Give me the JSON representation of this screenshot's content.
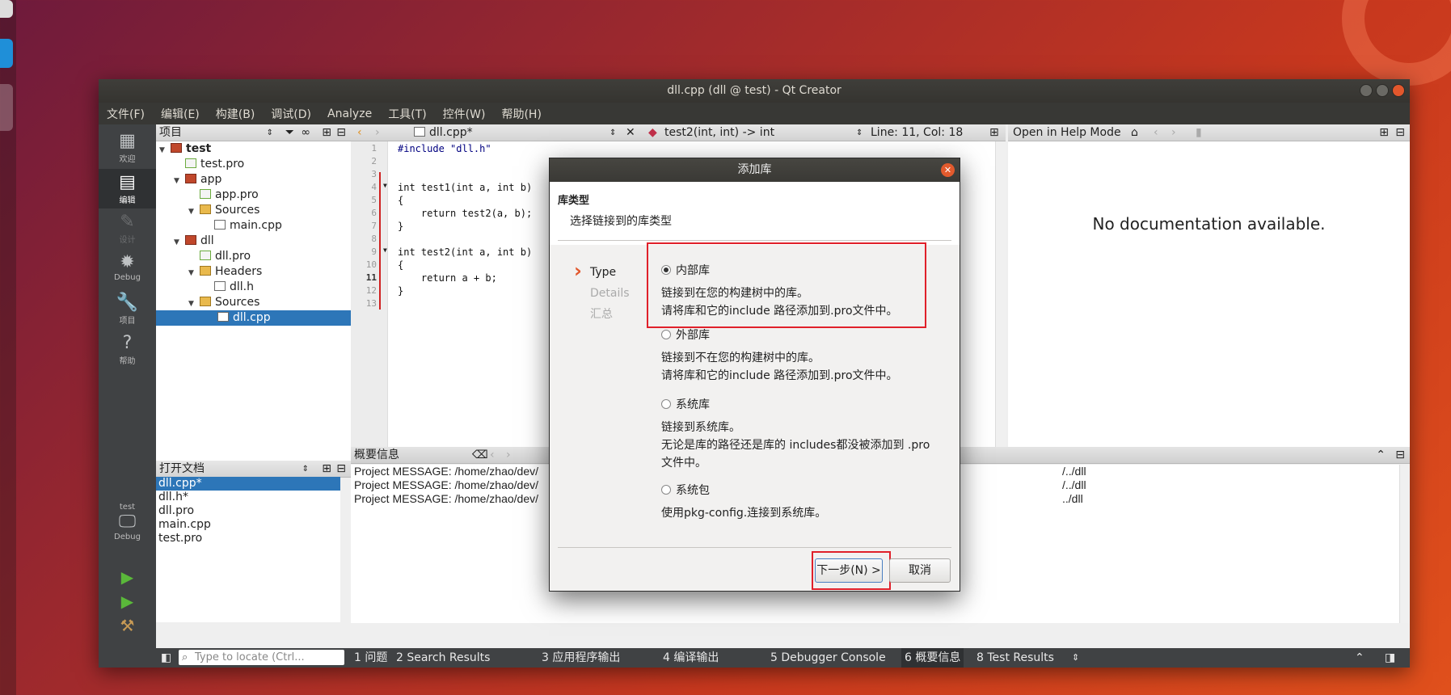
{
  "window": {
    "title": "dll.cpp (dll @ test) - Qt Creator"
  },
  "menu": [
    "文件(F)",
    "编辑(E)",
    "构建(B)",
    "调试(D)",
    "Analyze",
    "工具(T)",
    "控件(W)",
    "帮助(H)"
  ],
  "modes": [
    {
      "label": "欢迎",
      "icon": "grid-icon"
    },
    {
      "label": "编辑",
      "icon": "edit-icon"
    },
    {
      "label": "设计",
      "icon": "design-icon"
    },
    {
      "label": "Debug",
      "icon": "bug-icon"
    },
    {
      "label": "项目",
      "icon": "wrench-icon"
    },
    {
      "label": "帮助",
      "icon": "help-icon"
    }
  ],
  "kit": {
    "project": "test",
    "config": "Debug"
  },
  "project_pane": {
    "title": "项目"
  },
  "tree": [
    {
      "label": "test",
      "type": "proj",
      "bold": true
    },
    {
      "label": "test.pro",
      "type": "pro"
    },
    {
      "label": "app",
      "type": "proj"
    },
    {
      "label": "app.pro",
      "type": "pro"
    },
    {
      "label": "Sources",
      "type": "folder"
    },
    {
      "label": "main.cpp",
      "type": "file"
    },
    {
      "label": "dll",
      "type": "proj"
    },
    {
      "label": "dll.pro",
      "type": "pro"
    },
    {
      "label": "Headers",
      "type": "folder"
    },
    {
      "label": "dll.h",
      "type": "file"
    },
    {
      "label": "Sources",
      "type": "folder"
    },
    {
      "label": "dll.cpp",
      "type": "file",
      "selected": true
    }
  ],
  "open_docs": {
    "title": "打开文档",
    "items": [
      "dll.cpp*",
      "dll.h*",
      "dll.pro",
      "main.cpp",
      "test.pro"
    ]
  },
  "editor": {
    "file_tab": "dll.cpp*",
    "symbol": "test2(int, int) -> int",
    "position": "Line: 11, Col: 18",
    "line_numbers": [
      "1",
      "2",
      "3",
      "4",
      "5",
      "6",
      "7",
      "8",
      "9",
      "10",
      "11",
      "12",
      "13"
    ],
    "lines": [
      "#include \"dll.h\"",
      "",
      "",
      "int test1(int a, int b)",
      "{",
      "    return test2(a, b);",
      "}",
      "",
      "int test2(int a, int b)",
      "{",
      "    return a + b;",
      "}",
      ""
    ]
  },
  "help": {
    "mode_label": "Open in Help Mode",
    "message": "No documentation available."
  },
  "output": {
    "title": "概要信息",
    "lines_left": [
      "Project MESSAGE: /home/zhao/dev/",
      "Project MESSAGE: /home/zhao/dev/",
      "Project MESSAGE: /home/zhao/dev/"
    ],
    "lines_right": [
      "/../dll",
      "/../dll",
      "../dll"
    ]
  },
  "status": {
    "locate_placeholder": "Type to locate (Ctrl...",
    "tabs": [
      "1 问题",
      "2 Search Results",
      "3 应用程序输出",
      "4 编译输出",
      "5 Debugger Console",
      "6 概要信息",
      "8 Test Results"
    ]
  },
  "dialog": {
    "title": "添加库",
    "heading": "库类型",
    "subheading": "选择链接到的库类型",
    "steps": [
      "Type",
      "Details",
      "汇总"
    ],
    "options": [
      {
        "label": "内部库",
        "desc1": "链接到在您的构建树中的库。",
        "desc2": "请将库和它的include 路径添加到.pro文件中。",
        "selected": true
      },
      {
        "label": "外部库",
        "desc1": "链接到不在您的构建树中的库。",
        "desc2": "请将库和它的include 路径添加到.pro文件中。"
      },
      {
        "label": "系统库",
        "desc1": "链接到系统库。",
        "desc2": "无论是库的路径还是库的 includes都没被添加到 .pro",
        "desc3": "文件中。"
      },
      {
        "label": "系统包",
        "desc1": "使用pkg-config.连接到系统库。"
      }
    ],
    "next_button": "下一步(N) >",
    "cancel_button": "取消"
  }
}
